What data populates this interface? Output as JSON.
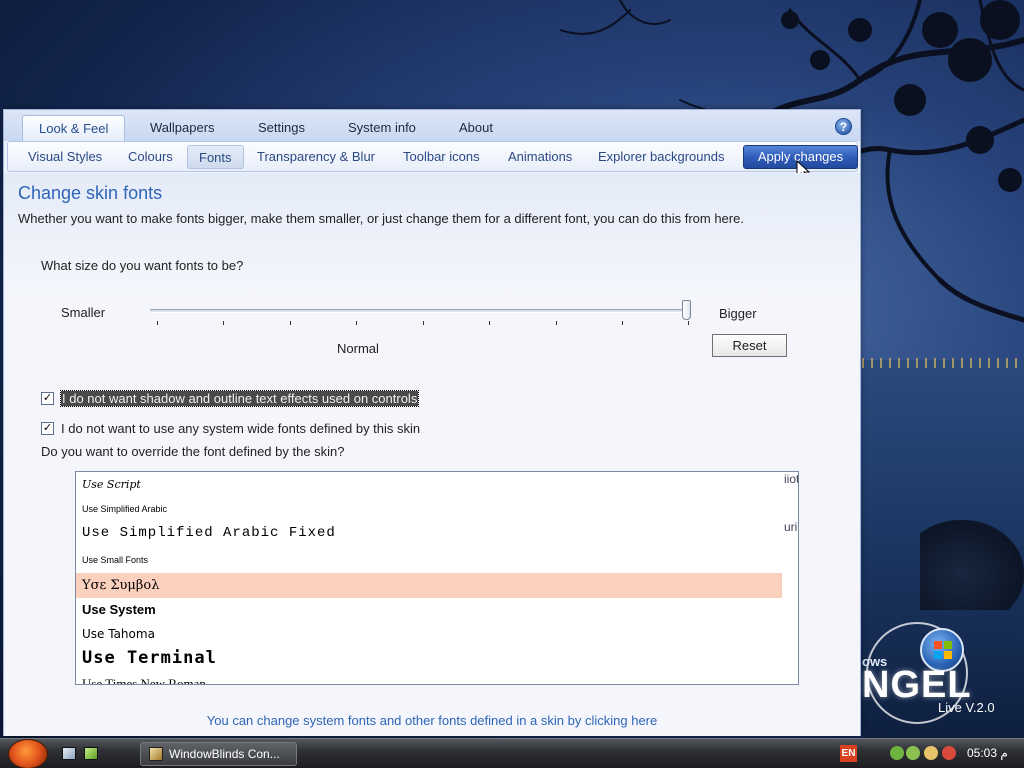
{
  "window": {
    "main_tabs": [
      {
        "label": "Look & Feel",
        "active": true
      },
      {
        "label": "Wallpapers",
        "active": false
      },
      {
        "label": "Settings",
        "active": false
      },
      {
        "label": "System info",
        "active": false
      },
      {
        "label": "About",
        "active": false
      }
    ],
    "help_glyph": "?",
    "sub_tabs": [
      {
        "label": "Visual Styles",
        "active": false
      },
      {
        "label": "Colours",
        "active": false
      },
      {
        "label": "Fonts",
        "active": true
      },
      {
        "label": "Transparency & Blur",
        "active": false
      },
      {
        "label": "Toolbar icons",
        "active": false
      },
      {
        "label": "Animations",
        "active": false
      },
      {
        "label": "Explorer backgrounds",
        "active": false
      }
    ],
    "apply_button": "Apply changes"
  },
  "content": {
    "title": "Change skin fonts",
    "description": "Whether you want to make fonts bigger, make them smaller, or just change them for a different font, you can do this from here.",
    "size_question": "What size do you want fonts to be?",
    "slider": {
      "min_label": "Smaller",
      "max_label": "Bigger",
      "center_label": "Normal",
      "ticks": 9,
      "value_fraction": 1.0
    },
    "reset_button": "Reset",
    "checkbox_shadow": {
      "label": "I do not want shadow and outline text effects used on controls",
      "checked": true,
      "selected": true
    },
    "checkbox_system_fonts": {
      "label": "I do not want to use any system wide fonts defined by this skin",
      "checked": true
    },
    "override_question": "Do you want to override the font defined by the skin?",
    "font_list": [
      {
        "label": "Use Script",
        "highlighted": false
      },
      {
        "label": "Use Simplified Arabic",
        "highlighted": false
      },
      {
        "label": "Use Simplified Arabic Fixed",
        "highlighted": false
      },
      {
        "label": "Use Small Fonts",
        "highlighted": false
      },
      {
        "label": "Υσε Συμβολ",
        "highlighted": true
      },
      {
        "label": "Use System",
        "highlighted": false
      },
      {
        "label": "Use Tahoma",
        "highlighted": false
      },
      {
        "label": "Use Terminal",
        "highlighted": false
      },
      {
        "label": "Use Times New Roman",
        "highlighted": false
      }
    ],
    "list_edge_text_1": "iiot",
    "list_edge_text_2": "uri",
    "footer_link": "You can change system fonts and other fonts defined in a skin by clicking here"
  },
  "desktop": {
    "brand_small": "ows",
    "brand_big": "NGEL",
    "brand_version": "Live V.2.0"
  },
  "taskbar": {
    "task_button": "WindowBlinds Con...",
    "language": "EN",
    "clock": "05:03 م"
  },
  "colors": {
    "accent_blue": "#2e65b8",
    "apply_button": "#2f5db9",
    "list_highlight": "#fbd1be",
    "taskbar": "#2e3034"
  }
}
